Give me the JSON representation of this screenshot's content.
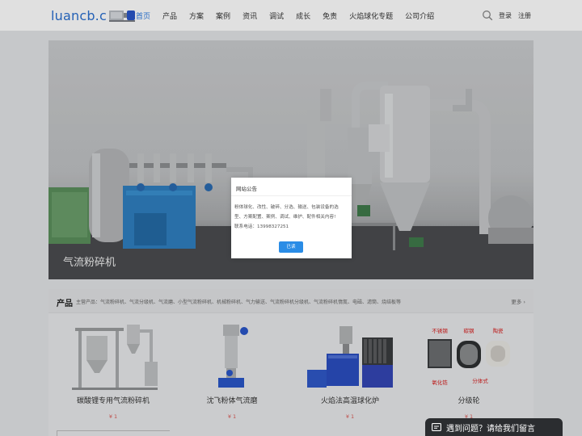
{
  "header": {
    "logo_text": "luancb.c",
    "nav": [
      "首页",
      "产品",
      "方案",
      "案例",
      "资讯",
      "调试",
      "成长",
      "免责",
      "火焰球化专题",
      "公司介绍"
    ],
    "active_index": 0,
    "search_icon": "search-icon",
    "login_label": "登录",
    "register_label": "注册",
    "accent_color": "#2a7ae2"
  },
  "banner": {
    "caption": "气流粉碎机"
  },
  "modal": {
    "title": "网站公告",
    "body_lines": [
      "粉体球化、改性、破碎、分选、输送、包装设备的选",
      "型、方案配置、案例、调试、维护、配件相关内容!",
      "联系电话：13998327251"
    ],
    "ok_label": "已读",
    "button_color": "#2a8ce6"
  },
  "products": {
    "title": "产品",
    "tags": "主营产品：气流粉碎机、气流分级机、气流磨、小型气流粉碎机、机械粉碎机、气力输送、气流粉碎机分级机、气流粉碎机惰氮、电磁、滤筒、烧结板等",
    "more_label": "更多",
    "items": [
      {
        "name": "碳酸锂专用气流粉碎机",
        "price": "¥ 1"
      },
      {
        "name": "沈飞粉体气流磨",
        "price": "¥ 1"
      },
      {
        "name": "火焰法高温球化炉",
        "price": "¥ 1"
      },
      {
        "name": "分级轮",
        "price": "¥ 1"
      }
    ],
    "wheel_labels": [
      "不锈钢",
      "碳钢",
      "陶瓷",
      "氧化锆",
      "分体式"
    ]
  },
  "chat": {
    "label": "遇到问题？请给我们留言"
  }
}
